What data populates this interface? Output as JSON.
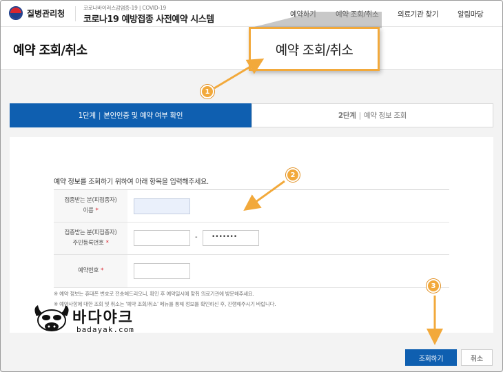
{
  "header": {
    "logo_text": "질병관리청",
    "subtitle": "코로나바이러스감염증-19 | COVID-19",
    "title": "코로나19 예방접종 사전예약 시스템",
    "nav": [
      "예약하기",
      "예약 조회/취소",
      "의료기관 찾기",
      "알림마당"
    ]
  },
  "page": {
    "title": "예약 조회/취소"
  },
  "callout": {
    "label": "예약 조회/취소"
  },
  "steps": {
    "step1": {
      "num": "1단계",
      "label": "본인인증 및 예약 여부 확인"
    },
    "step2": {
      "num": "2단계",
      "label": "예약 정보 조회"
    }
  },
  "form": {
    "instruction": "예약 정보를 조회하기 위하여 아래 항목을 입력해주세요.",
    "rows": [
      {
        "line1": "접종받는 분(피접종자)",
        "line2": "이름",
        "required": "*"
      },
      {
        "line1": "접종받는 분(피접종자)",
        "line2": "주민등록번호",
        "required": "*"
      },
      {
        "line1": "예약번호",
        "required": "*"
      }
    ],
    "id_dash": "-",
    "id_masked": "•••••••",
    "notes": [
      "※ 예약 정보는 휴대폰 번호로 전송해드리오니, 확인 후 예약일시에 맞춰 의료기관에 방문해주세요.",
      "※ 예약사항에 대한 조회 및 취소는 '예약 조회/취소' 메뉴를 통해 정보를 확인하신 후, 진행해주시기 바랍니다."
    ]
  },
  "buttons": {
    "submit": "조회하기",
    "cancel": "취소"
  },
  "markers": [
    "1",
    "2",
    "3"
  ],
  "watermark": {
    "text": "바다야크",
    "sub": "badayak.com"
  },
  "colors": {
    "primary": "#0f5fb0",
    "accent": "#f2a93b",
    "required": "#d9262f"
  }
}
